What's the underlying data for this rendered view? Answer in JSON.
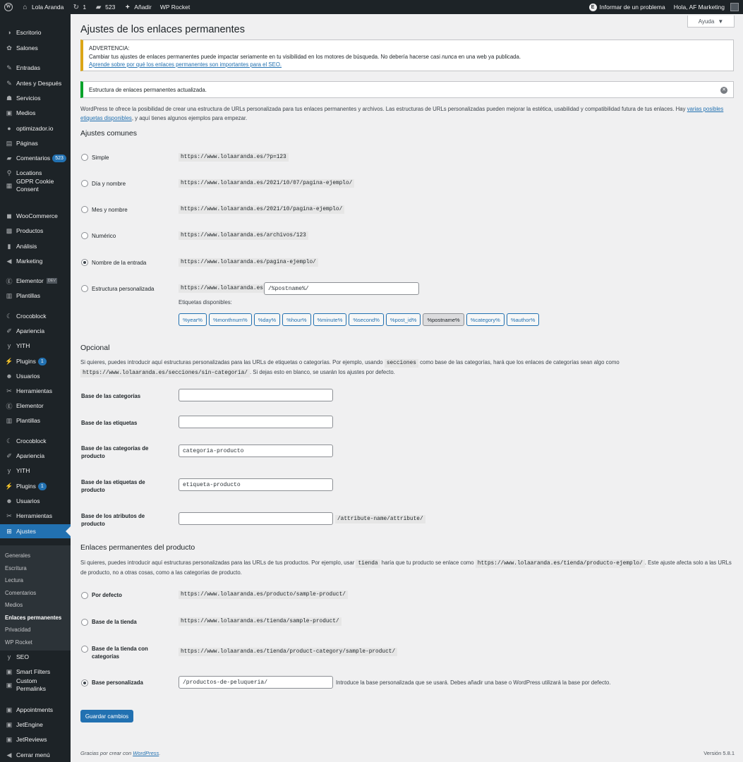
{
  "adminbar": {
    "site_name": "Lola Aranda",
    "updates_count": "1",
    "comments_count": "523",
    "add_new": "Añadir",
    "wp_rocket": "WP Rocket",
    "report_issue": "Informar de un problema",
    "greeting": "Hola, AF Marketing"
  },
  "sidebar": {
    "items": [
      {
        "label": "Escritorio",
        "icon": "dashboard-icon",
        "glyph": "◑"
      },
      {
        "label": "Salones",
        "icon": "salon-icon",
        "glyph": "✿"
      },
      {
        "label": "Entradas",
        "icon": "pin-icon",
        "glyph": "✎"
      },
      {
        "label": "Antes y Después",
        "icon": "pin-icon",
        "glyph": "✎"
      },
      {
        "label": "Servicios",
        "icon": "groups-icon",
        "glyph": "☗"
      },
      {
        "label": "Medios",
        "icon": "media-icon",
        "glyph": "▣"
      },
      {
        "label": "optimizador.io",
        "icon": "optimizer-icon",
        "glyph": "●"
      },
      {
        "label": "Páginas",
        "icon": "pages-icon",
        "glyph": "▤"
      },
      {
        "label": "Comentarios",
        "icon": "comments-icon",
        "glyph": "▰",
        "count": "523"
      },
      {
        "label": "Locations",
        "icon": "location-icon",
        "glyph": "⚲"
      },
      {
        "label": "GDPR Cookie Consent",
        "icon": "cookie-icon",
        "glyph": "▦"
      },
      {
        "label": "WooCommerce",
        "icon": "woocommerce-icon",
        "glyph": "◼"
      },
      {
        "label": "Productos",
        "icon": "products-icon",
        "glyph": "▩"
      },
      {
        "label": "Análisis",
        "icon": "analytics-icon",
        "glyph": "▮"
      },
      {
        "label": "Marketing",
        "icon": "megaphone-icon",
        "glyph": "◀"
      },
      {
        "label": "Elementor",
        "icon": "elementor-icon",
        "glyph": "Ⓔ",
        "badge": "DEV"
      },
      {
        "label": "Plantillas",
        "icon": "templates-icon",
        "glyph": "▥"
      },
      {
        "label": "Crocoblock",
        "icon": "crocoblock-icon",
        "glyph": "☾"
      },
      {
        "label": "Apariencia",
        "icon": "brush-icon",
        "glyph": "✐"
      },
      {
        "label": "YITH",
        "icon": "yith-icon",
        "glyph": "y"
      },
      {
        "label": "Plugins",
        "icon": "plugins-icon",
        "glyph": "⚡",
        "count": "1"
      },
      {
        "label": "Usuarios",
        "icon": "users-icon",
        "glyph": "☻"
      },
      {
        "label": "Herramientas",
        "icon": "tools-icon",
        "glyph": "✂"
      },
      {
        "label": "Elementor",
        "icon": "elementor-icon",
        "glyph": "Ⓔ"
      },
      {
        "label": "Plantillas",
        "icon": "templates-icon",
        "glyph": "▥"
      },
      {
        "label": "Crocoblock",
        "icon": "crocoblock-icon",
        "glyph": "☾"
      },
      {
        "label": "Apariencia",
        "icon": "brush-icon",
        "glyph": "✐"
      },
      {
        "label": "YITH",
        "icon": "yith-icon",
        "glyph": "y"
      },
      {
        "label": "Plugins",
        "icon": "plugins-icon",
        "glyph": "⚡",
        "count": "1"
      },
      {
        "label": "Usuarios",
        "icon": "users-icon",
        "glyph": "☻"
      },
      {
        "label": "Herramientas",
        "icon": "tools-icon",
        "glyph": "✂"
      },
      {
        "label": "Ajustes",
        "icon": "settings-icon",
        "glyph": "⊞"
      },
      {
        "label": "SEO",
        "icon": "seo-icon",
        "glyph": "y"
      },
      {
        "label": "Smart Filters",
        "icon": "jet-icon",
        "glyph": "▣"
      },
      {
        "label": "Custom Permalinks",
        "icon": "jet-icon",
        "glyph": "▣"
      },
      {
        "label": "Appointments",
        "icon": "jet-icon",
        "glyph": "▣"
      },
      {
        "label": "JetEngine",
        "icon": "jet-icon",
        "glyph": "▣"
      },
      {
        "label": "JetReviews",
        "icon": "jet-icon",
        "glyph": "▣"
      },
      {
        "label": "Cerrar menú",
        "icon": "collapse-icon",
        "glyph": "◀"
      }
    ],
    "submenu": [
      "Generales",
      "Escritura",
      "Lectura",
      "Comentarios",
      "Medios",
      "Enlaces permanentes",
      "Privacidad",
      "WP Rocket"
    ],
    "accent": "#2271b1"
  },
  "page": {
    "title": "Ajustes de los enlaces permanentes",
    "help": "Ayuda",
    "warning": {
      "title": "ADVERTENCIA:",
      "text_before": "Cambiar tus ajustes de enlaces permanentes puede impactar seriamente en tu visibilidad en los motores de búsqueda. No debería hacerse casi ",
      "text_em": "nunca",
      "text_after": " en una web ya publicada.",
      "link": "Aprende sobre por qué los enlaces permanentes son importantes para el SEO."
    },
    "success": "Estructura de enlaces permanentes actualizada.",
    "intro_text": "WordPress te ofrece la posibilidad de crear una estructura de URLs personalizada para tus enlaces permanentes y archivos. Las estructuras de URLs personalizadas pueden mejorar la estética, usabilidad y compatibilidad futura de tus enlaces. Hay ",
    "intro_link": "varias posibles etiquetas disponibles",
    "intro_end": ", y aquí tienes algunos ejemplos para empezar.",
    "common_heading": "Ajustes comunes",
    "common": [
      {
        "label": "Simple",
        "example": "https://www.lolaaranda.es/?p=123",
        "checked": false
      },
      {
        "label": "Día y nombre",
        "example": "https://www.lolaaranda.es/2021/10/07/pagina-ejemplo/",
        "checked": false
      },
      {
        "label": "Mes y nombre",
        "example": "https://www.lolaaranda.es/2021/10/pagina-ejemplo/",
        "checked": false
      },
      {
        "label": "Numérico",
        "example": "https://www.lolaaranda.es/archivos/123",
        "checked": false
      },
      {
        "label": "Nombre de la entrada",
        "example": "https://www.lolaaranda.es/pagina-ejemplo/",
        "checked": true
      },
      {
        "label": "Estructura personalizada",
        "example": "https://www.lolaaranda.es",
        "checked": false
      }
    ],
    "custom_structure_value": "/%postname%/",
    "tags_label": "Etiquetas disponibles:",
    "tags": [
      "%year%",
      "%monthnum%",
      "%day%",
      "%hour%",
      "%minute%",
      "%second%",
      "%post_id%",
      "%postname%",
      "%category%",
      "%author%"
    ],
    "active_tag": "%postname%",
    "optional_heading": "Opcional",
    "optional_text_1": "Si quieres, puedes introducir aquí estructuras personalizadas para las URLs de etiquetas o categorías. Por ejemplo, usando ",
    "optional_code_1": "secciones",
    "optional_text_2": " como base de las categorías, hará que los enlaces de categorías sean algo como",
    "optional_code_2": "https://www.lolaaranda.es/secciones/sin-categoria/",
    "optional_text_3": ". Si dejas esto en blanco, se usarán los ajustes por defecto.",
    "fields": [
      {
        "label": "Base de las categorías",
        "value": ""
      },
      {
        "label": "Base de las etiquetas",
        "value": ""
      },
      {
        "label": "Base de las categorías de producto",
        "value": "categoria-producto"
      },
      {
        "label": "Base de las etiquetas de producto",
        "value": "etiqueta-producto"
      },
      {
        "label": "Base de los atributos de producto",
        "value": "",
        "suffix": "/attribute-name/attribute/"
      }
    ],
    "product_heading": "Enlaces permanentes del producto",
    "product_text_1": "Si quieres, puedes introducir aquí estructuras personalizadas para las URLs de tus productos. Por ejemplo, usar ",
    "product_code_1": "tienda",
    "product_text_2": " haría que tu producto se enlace como ",
    "product_code_2": "https://www.lolaaranda.es/tienda/producto-ejemplo/",
    "product_text_3": ". Este ajuste afecta solo a las URLs de producto, no a otras cosas, como a las categorías de producto.",
    "product_options": [
      {
        "label": "Por defecto",
        "example": "https://www.lolaaranda.es/producto/sample-product/",
        "checked": false
      },
      {
        "label": "Base de la tienda",
        "example": "https://www.lolaaranda.es/tienda/sample-product/",
        "checked": false
      },
      {
        "label": "Base de la tienda con categorías",
        "example": "https://www.lolaaranda.es/tienda/product-category/sample-product/",
        "checked": false
      },
      {
        "label": "Base personalizada",
        "value": "/productos-de-peluqueria/",
        "checked": true
      }
    ],
    "custom_base_hint": "Introduce la base personalizada que se usará. Debes añadir una base o WordPress utilizará la base por defecto.",
    "save": "Guardar cambios",
    "footer_text": "Gracias por crear con ",
    "footer_link": "WordPress",
    "version": "Versión 5.8.1"
  }
}
